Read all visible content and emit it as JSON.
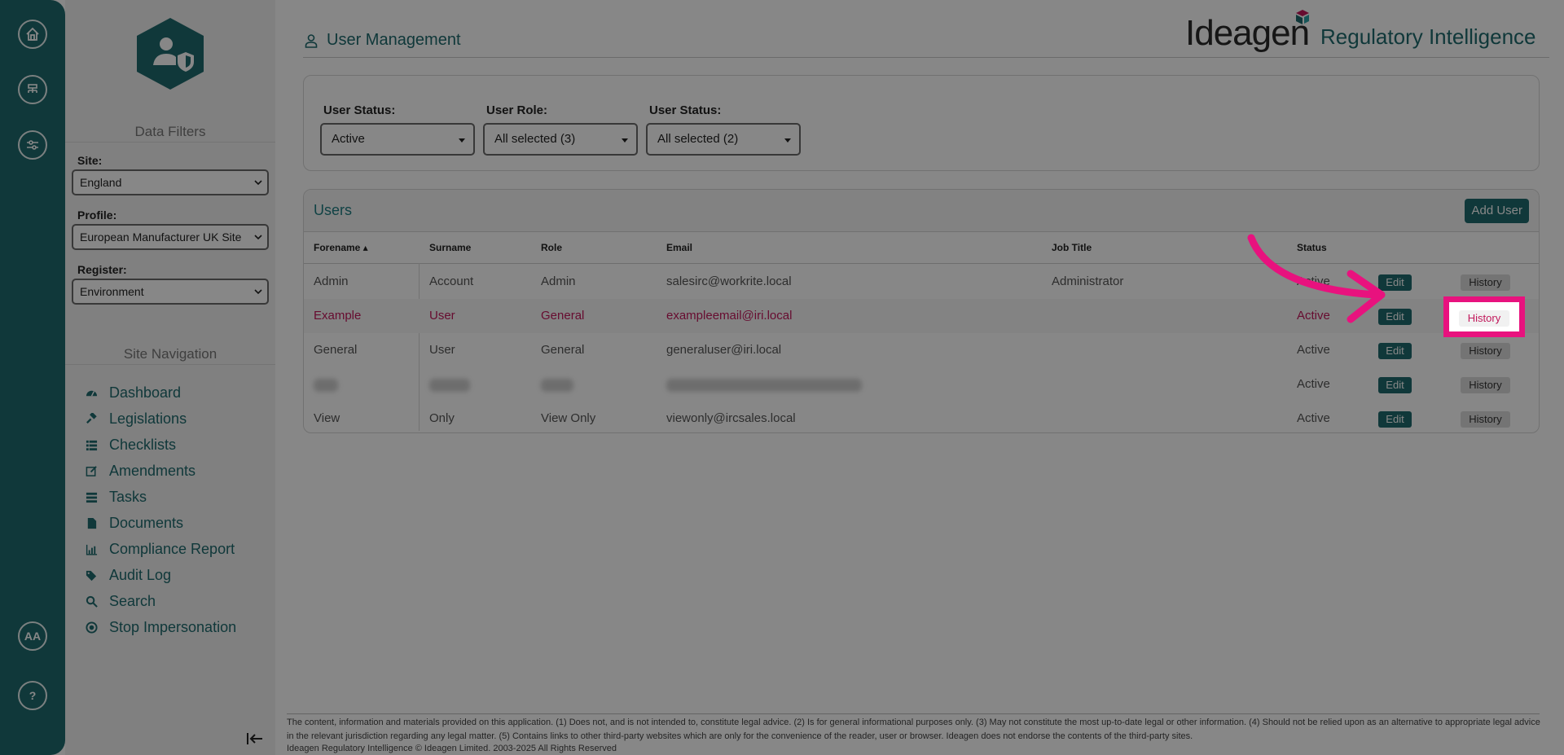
{
  "rail": {
    "aa_label": "AA",
    "help_label": "?"
  },
  "sidebar": {
    "data_filters_title": "Data Filters",
    "filters": [
      {
        "label": "Site:",
        "value": "England"
      },
      {
        "label": "Profile:",
        "value": "European Manufacturer UK Site"
      },
      {
        "label": "Register:",
        "value": "Environment"
      }
    ],
    "site_navigation_title": "Site Navigation",
    "nav": [
      "Dashboard",
      "Legislations",
      "Checklists",
      "Amendments",
      "Tasks",
      "Documents",
      "Compliance Report",
      "Audit Log",
      "Search",
      "Stop Impersonation"
    ]
  },
  "header": {
    "title": "User Management",
    "brand_name": "Ideagen",
    "brand_product": "Regulatory Intelligence"
  },
  "user_filters": [
    {
      "label": "User Status:",
      "value": "Active"
    },
    {
      "label": "User Role:",
      "value": "All selected (3)"
    },
    {
      "label": "User Status:",
      "value": "All selected (2)"
    }
  ],
  "users": {
    "title": "Users",
    "add_label": "Add User",
    "columns": [
      "Forename ▴",
      "Surname",
      "Role",
      "Email",
      "Job Title",
      "Status"
    ],
    "edit_label": "Edit",
    "history_label": "History",
    "rows": [
      {
        "forename": "Admin",
        "surname": "Account",
        "role": "Admin",
        "email": "salesirc@workrite.local",
        "job_title": "Administrator",
        "status": "Active"
      },
      {
        "forename": "Example",
        "surname": "User",
        "role": "General",
        "email": "exampleemail@iri.local",
        "job_title": "",
        "status": "Active"
      },
      {
        "forename": "General",
        "surname": "User",
        "role": "General",
        "email": "generaluser@iri.local",
        "job_title": "",
        "status": "Active"
      },
      {
        "forename": "",
        "surname": "",
        "role": "",
        "email": "",
        "job_title": "",
        "status": "Active"
      },
      {
        "forename": "View",
        "surname": "Only",
        "role": "View Only",
        "email": "viewonly@ircsales.local",
        "job_title": "",
        "status": "Active"
      }
    ]
  },
  "footer": {
    "disclaimer": "The content, information and materials provided on this application. (1) Does not, and is not intended to, constitute legal advice. (2) Is for general informational purposes only. (3) May not constitute the most up-to-date legal or other information. (4) Should not be relied upon as an alternative to appropriate legal advice in the relevant jurisdiction regarding any legal matter. (5) Contains links to other third-party websites which are only for the convenience of the reader, user or browser. Ideagen does not endorse the contents of the third-party sites.",
    "copyright": "Ideagen Regulatory Intelligence © Ideagen Limited. 2003-2025 All Rights Reserved"
  },
  "colors": {
    "teal": "#1f6b6e",
    "highlight": "#e8127e",
    "hover_text": "#c2185b"
  }
}
